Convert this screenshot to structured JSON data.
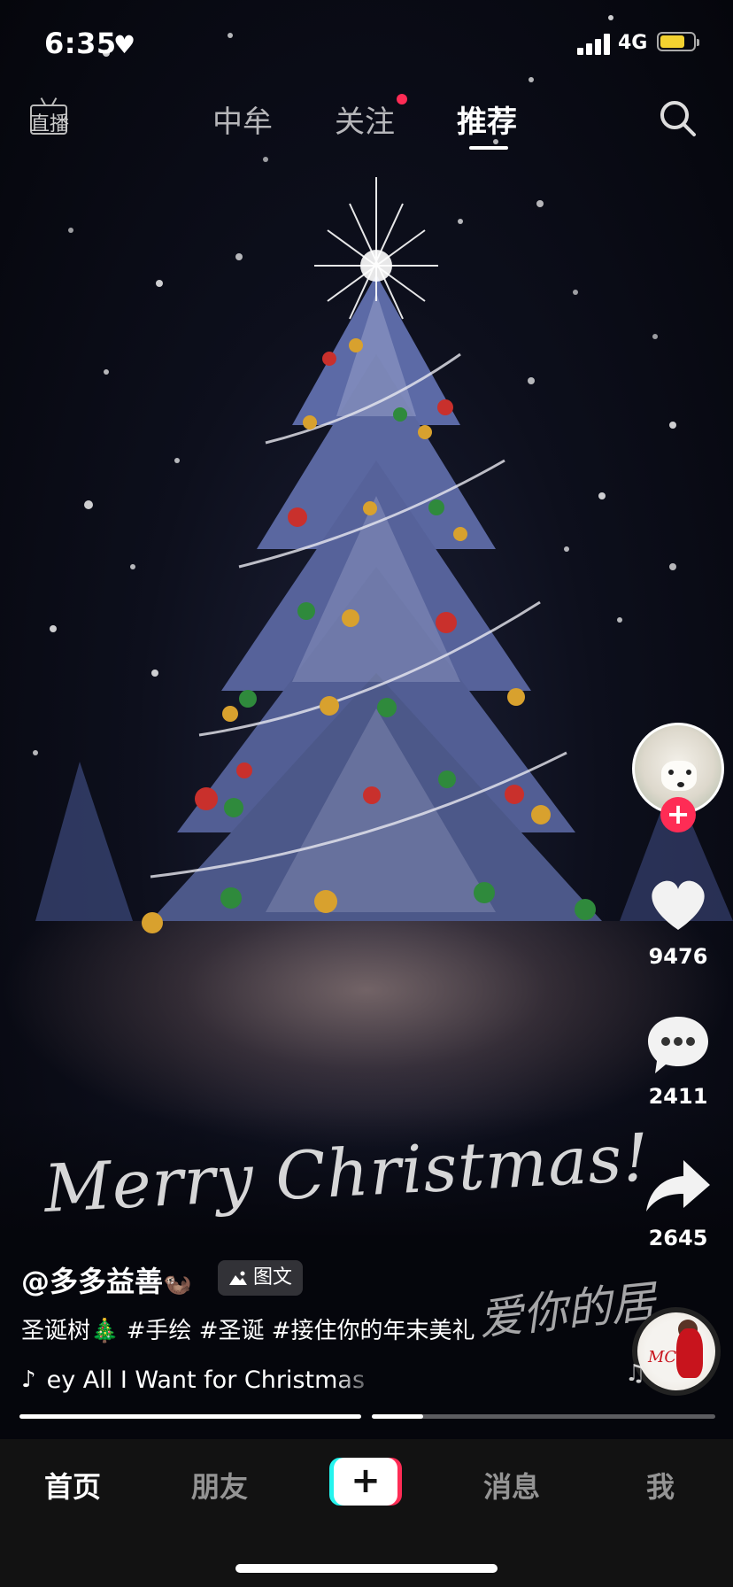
{
  "status_bar": {
    "time": "6:35",
    "network": "4G",
    "battery_level": 0.75
  },
  "top_nav": {
    "live_label": "直播",
    "tabs": [
      "中牟",
      "关注",
      "推荐"
    ],
    "active_tab": "推荐"
  },
  "video": {
    "author": "@多多益善",
    "type_tag": "图文",
    "description": "圣诞树🎄 #手绘 #圣诞 #接住你的年末美礼",
    "music": "ey   All I Want for Christmas",
    "overlay_text": "Merry Christmas!",
    "overlay_handwriting": "爱你的居"
  },
  "actions": {
    "likes": "9476",
    "comments": "2411",
    "shares": "2645"
  },
  "progress": {
    "segments": 2,
    "current_segment_progress": 0.15
  },
  "bottom_nav": {
    "home": "首页",
    "friends": "朋友",
    "add": "+",
    "messages": "消息",
    "me": "我"
  },
  "colors": {
    "accent": "#fe2c55",
    "cyan": "#25f4ee",
    "battery": "#f3d230"
  }
}
